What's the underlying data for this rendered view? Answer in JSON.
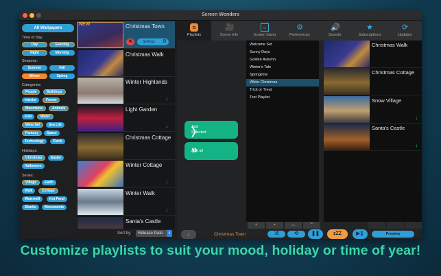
{
  "window": {
    "title": "Screen Wonders"
  },
  "sidebar": {
    "all_label": "All Wallpapers",
    "time_label": "Time of Day:",
    "time": [
      "Day",
      "Evening",
      "Night",
      "Morning"
    ],
    "seasons_label": "Seasons:",
    "seasons": [
      "Summer",
      "Fall",
      "Winter",
      "Spring"
    ],
    "categories_label": "Categories:",
    "categories": [
      "People",
      "Buildings",
      "Interior",
      "Forest",
      "Mountains",
      "Animals",
      "Fish",
      "Water",
      "Waterfall",
      "Sea Life",
      "Fantasy",
      "Space",
      "Technology",
      "Clock"
    ],
    "holidays_label": "Holidays:",
    "holidays": [
      "Christmas",
      "Easter",
      "Halloween"
    ],
    "series_label": "Series:",
    "series": [
      "Village",
      "Earth",
      "Walk",
      "Cottage",
      "Watermill",
      "Koi Pond",
      "Sharks",
      "Monuments"
    ]
  },
  "wallpapers": {
    "new_badge": "NEW",
    "settings_label": "Settings",
    "items": [
      "Christmas Town",
      "Christmas Walk",
      "Winter Highlands",
      "Light Garden",
      "Christmas Cottage",
      "Winter Cottage",
      "Winter Walk",
      "Santa's Castle"
    ],
    "sort_label": "Sort by:",
    "sort_value": "Release Date"
  },
  "tabs": [
    {
      "label": "Playlists",
      "icon": "list-icon"
    },
    {
      "label": "Scene Info",
      "icon": "camera-icon"
    },
    {
      "label": "Screen Saver",
      "icon": "monitor-icon"
    },
    {
      "label": "Preferences",
      "icon": "preferences-icon"
    },
    {
      "label": "Sounds",
      "icon": "speaker-icon"
    },
    {
      "label": "Subscriptions",
      "icon": "star-icon"
    },
    {
      "label": "Updates",
      "icon": "refresh-icon"
    }
  ],
  "actions": {
    "add_selected_1": "Add",
    "add_selected_2": "Selected",
    "add_all": "Add all"
  },
  "playlists": {
    "items": [
      "Welcome Set",
      "Sunny Days",
      "Golden Autumn",
      "Winter's Tale",
      "Springtime",
      "White Christmas",
      "Trick or Treat",
      "Test Playlist"
    ],
    "selected": "White Christmas"
  },
  "playlist_contents": [
    "Christmas Walk",
    "Christmas Cottage",
    "Snow Village",
    "Santa's Castle"
  ],
  "player": {
    "now_playing": "Christmas Town",
    "sleep_label": "zZZ",
    "preview_label": "Preview"
  },
  "caption": "Customize playlists to suit your mood, holiday or time of year!",
  "colors": {
    "accent": "#2e9fd8",
    "selected_tag": "#f08a30",
    "add_button": "#14b386",
    "caption": "#3ad6a5"
  }
}
